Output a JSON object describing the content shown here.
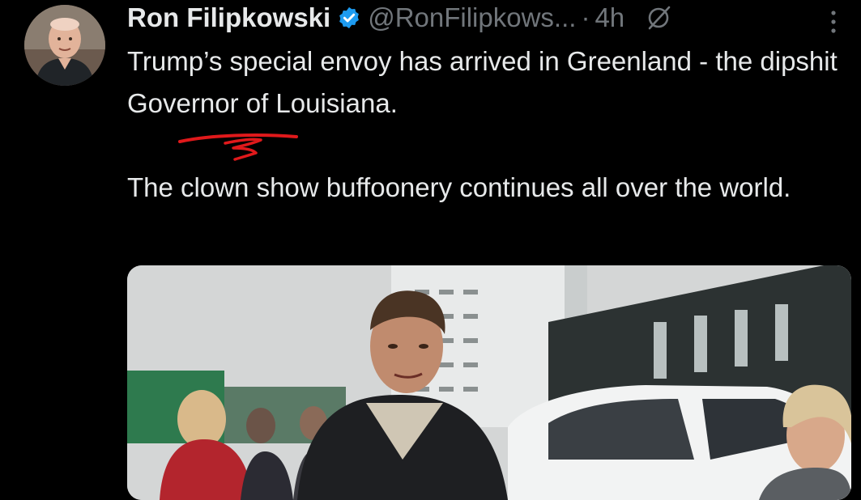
{
  "tweet": {
    "author": {
      "display_name": "Ron Filipkowski",
      "handle": "@RonFilipkows...",
      "verified_icon": "verified-badge-icon",
      "avatar_icon": "avatar"
    },
    "separator": "·",
    "timestamp": "4h",
    "grok_icon": "grok-slash-icon",
    "more_icon": "more-vertical-icon",
    "text_paragraphs": [
      "Trump’s special envoy has arrived in Greenland - the dipshit Governor of Louisiana.",
      "The clown show buffoonery continues all over the world."
    ],
    "annotation": "red-handwritten-underline",
    "media": {
      "type": "video-still",
      "description_icon": "video-thumbnail"
    }
  },
  "colors": {
    "background": "#000000",
    "text_primary": "#e7e9ea",
    "text_secondary": "#71767b",
    "verified_blue": "#1d9bf0",
    "annotation_red": "#e0191b"
  }
}
